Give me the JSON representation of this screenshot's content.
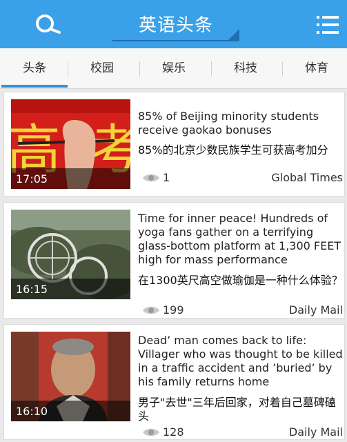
{
  "header": {
    "title": "英语头条",
    "icons": {
      "search": "search-icon",
      "menu": "menu-list-icon"
    },
    "accent": "#3aa0e8"
  },
  "tabs": [
    {
      "label": "头条",
      "active": true
    },
    {
      "label": "校园",
      "active": false
    },
    {
      "label": "娱乐",
      "active": false
    },
    {
      "label": "科技",
      "active": false
    },
    {
      "label": "体育",
      "active": false
    }
  ],
  "articles": [
    {
      "duration": "17:05",
      "title_en": "85% of Beijing minority students receive gaokao bonuses",
      "title_zh": "85%的北京少数民族学生可获高考加分",
      "views": "1",
      "source": "Global Times"
    },
    {
      "duration": "16:15",
      "title_en": "Time for inner peace! Hundreds of yoga fans gather on a terrifying glass-bottom platform at 1,300 FEET high for mass performance",
      "title_zh": "在1300英尺高空做瑜伽是一种什么体验？",
      "views": "199",
      "source": "Daily Mail"
    },
    {
      "duration": "16:10",
      "title_en": "Dead’ man comes back to life: Villager who was thought to be killed in a traffic accident and ’buried’ by his family returns home",
      "title_zh": "男子\"去世\"三年后回家，对着自己墓碑磕头",
      "views": "128",
      "source": "Daily Mail"
    }
  ]
}
